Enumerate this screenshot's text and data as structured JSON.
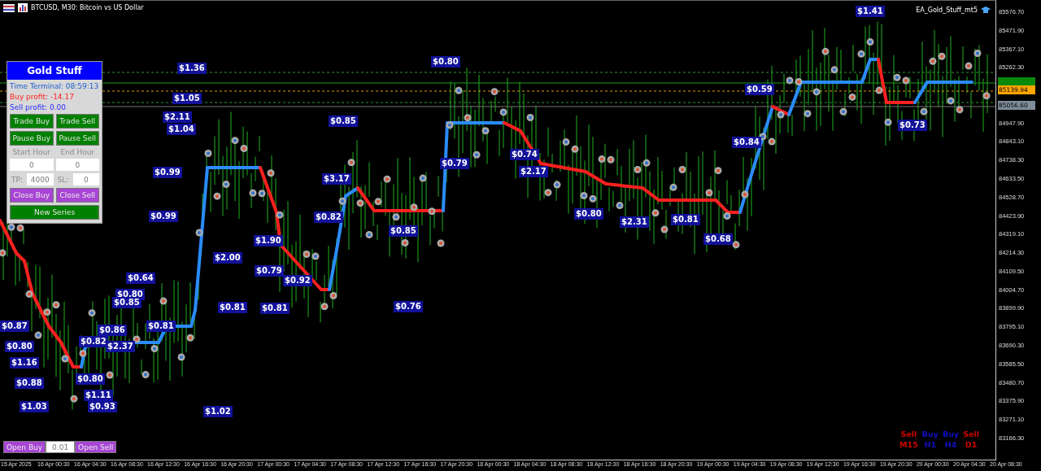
{
  "chart_header": {
    "symbol_title": "BTCUSD, M30: Bitcoin vs US Dollar",
    "expert_name": "EA_Gold_Stuff_mt5"
  },
  "panel": {
    "title": "Gold Stuff",
    "time_text": "Time Terminal: 08:59:13",
    "buy_profit": "Buy profit: -14.17",
    "sell_profit": "Sell profit: 0.00",
    "trade_buttons": [
      "Trade Buy",
      "Trade Sell"
    ],
    "pause_buttons": [
      "Pause Buy",
      "Pause Sell"
    ],
    "hour_labels": [
      "Start Hour",
      "End Hour"
    ],
    "hour_fields": [
      "0",
      "0"
    ],
    "tp_label": "TP:",
    "tp_value": "4000",
    "sl_label": "SL:",
    "sl_value": "0",
    "close_buttons": [
      "Close Buy",
      "Close Sell"
    ],
    "new_series_button": "New Series"
  },
  "order_bar": {
    "open_buy": "Open Buy",
    "lot": "0.01",
    "open_sell": "Open Sell"
  },
  "trade_labels": [
    "$1.36",
    "$1.05",
    "$2.11",
    "$1.04",
    "$0.99",
    "$0.99",
    "$0.64",
    "$0.80",
    "$0.85",
    "$0.87",
    "$0.80",
    "$1.16",
    "$0.88",
    "$1.03",
    "$0.86",
    "$0.82",
    "$2.37",
    "$0.81",
    "$0.80",
    "$1.11",
    "$0.93",
    "$1.02",
    "$2.00",
    "$0.81",
    "$0.79",
    "$1.90",
    "$0.81",
    "$0.92",
    "$0.85",
    "$0.82",
    "$3.17",
    "$0.85",
    "$0.76",
    "$0.80",
    "$0.79",
    "$2.17",
    "$0.74",
    "$0.80",
    "$2.31",
    "$0.81",
    "$0.68",
    "$0.73",
    "$1.41",
    "$0.59",
    "$0.84"
  ],
  "signals": [
    {
      "signal": "Sell",
      "timeframe": "M15",
      "color": "#d00000"
    },
    {
      "signal": "Buy",
      "timeframe": "H1",
      "color": "#1010c0"
    },
    {
      "signal": "Buy",
      "timeframe": "H4",
      "color": "#1010c0"
    },
    {
      "signal": "Sell",
      "timeframe": "D1",
      "color": "#d00000"
    }
  ],
  "price_axis": [
    "85576.70",
    "85471.90",
    "85367.10",
    "85262.30",
    "84947.90",
    "84843.10",
    "84738.30",
    "84633.50",
    "84528.70",
    "84423.90",
    "84319.10",
    "84214.30",
    "84109.50",
    "84004.70",
    "83899.90",
    "83795.10",
    "83690.30",
    "83585.50",
    "83480.70",
    "83375.90",
    "83271.10",
    "83166.30"
  ],
  "price_tags": [
    {
      "text": "85139.94",
      "color": "#ffa500"
    },
    {
      "text": "85056.60",
      "color": "#7f8c99"
    }
  ],
  "time_axis": [
    "15 Apr 2025",
    "16 Apr 00:30",
    "16 Apr 04:30",
    "16 Apr 08:30",
    "16 Apr 12:30",
    "16 Apr 16:30",
    "16 Apr 20:30",
    "17 Apr 00:30",
    "17 Apr 04:30",
    "17 Apr 08:30",
    "17 Apr 12:30",
    "17 Apr 16:30",
    "17 Apr 20:30",
    "18 Apr 00:30",
    "18 Apr 04:30",
    "18 Apr 08:30",
    "18 Apr 12:30",
    "18 Apr 16:30",
    "18 Apr 20:30",
    "19 Apr 00:30",
    "19 Apr 04:30",
    "19 Apr 08:30",
    "19 Apr 12:30",
    "19 Apr 16:30",
    "19 Apr 20:30",
    "20 Apr 00:30",
    "20 Apr 04:30",
    "20 Apr 08:30"
  ]
}
